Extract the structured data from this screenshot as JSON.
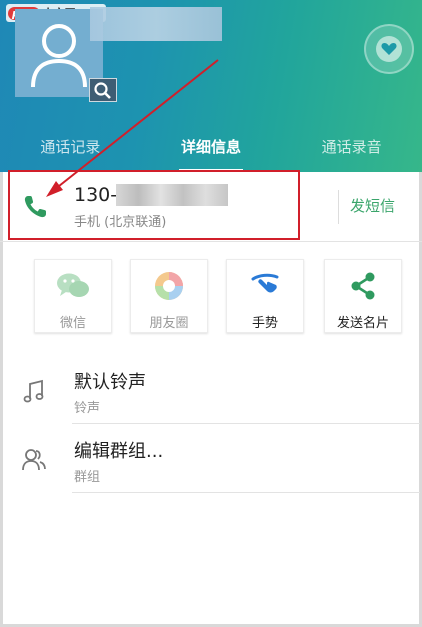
{
  "watermark": {
    "logo": "php",
    "text": "中文网"
  },
  "tabs": [
    {
      "label": "通话记录"
    },
    {
      "label": "详细信息"
    },
    {
      "label": "通话录音"
    }
  ],
  "phone": {
    "number_prefix": "130-",
    "type_label": "手机 (北京联通)",
    "sms_label": "发短信"
  },
  "share": [
    {
      "label": "微信"
    },
    {
      "label": "朋友圈"
    },
    {
      "label": "手势"
    },
    {
      "label": "发送名片"
    }
  ],
  "settings": [
    {
      "title": "默认铃声",
      "subtitle": "铃声"
    },
    {
      "title": "编辑群组...",
      "subtitle": "群组"
    }
  ],
  "colors": {
    "accent_green": "#3aa56b",
    "annotation_red": "#d11f2a",
    "header_start": "#1f88b6",
    "header_end": "#36b78a"
  },
  "icons": {
    "avatar": "person-icon",
    "avatar_action": "search-icon",
    "favorite": "heart-icon",
    "phone": "phone-icon",
    "wechat": "wechat-icon",
    "moments": "moments-icon",
    "gesture": "gesture-icon",
    "share_card": "share-icon",
    "ringtone": "music-note-icon",
    "group": "group-icon"
  }
}
